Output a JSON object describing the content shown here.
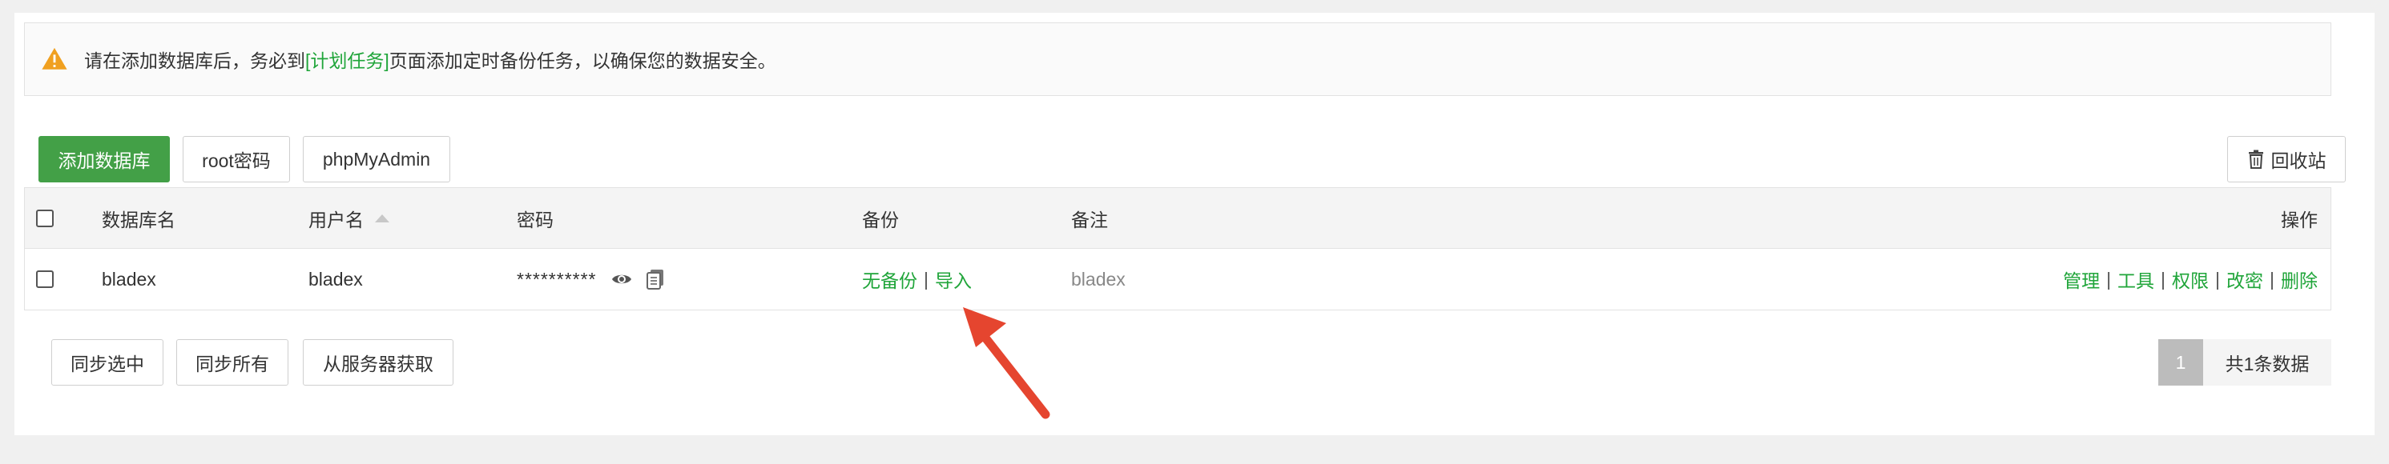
{
  "notice": {
    "before": "请在添加数据库后，务必到",
    "link": "[计划任务]",
    "after": "页面添加定时备份任务，以确保您的数据安全。"
  },
  "toolbar": {
    "add_db": "添加数据库",
    "root_pwd": "root密码",
    "phpmyadmin": "phpMyAdmin",
    "recycle": "回收站"
  },
  "table": {
    "headers": {
      "db_name": "数据库名",
      "username": "用户名",
      "password": "密码",
      "backup": "备份",
      "note": "备注",
      "actions": "操作"
    },
    "rows": [
      {
        "db_name": "bladex",
        "username": "bladex",
        "password": "**********",
        "backup_status": "无备份",
        "import": "导入",
        "note": "bladex",
        "actions": [
          "管理",
          "工具",
          "权限",
          "改密",
          "删除"
        ]
      }
    ]
  },
  "footer": {
    "sync_selected": "同步选中",
    "sync_all": "同步所有",
    "fetch_server": "从服务器获取",
    "page": "1",
    "total": "共1条数据"
  },
  "colors": {
    "accent_green": "#20a53a",
    "primary_button": "#43a047",
    "annotation_arrow": "#e5452f"
  },
  "icons": {
    "notice": "warning-icon",
    "recycle": "trash-icon",
    "show_password": "eye-icon",
    "copy_password": "copy-icon",
    "sort": "sort-asc-icon",
    "annotation": "red-arrow-annotation"
  }
}
